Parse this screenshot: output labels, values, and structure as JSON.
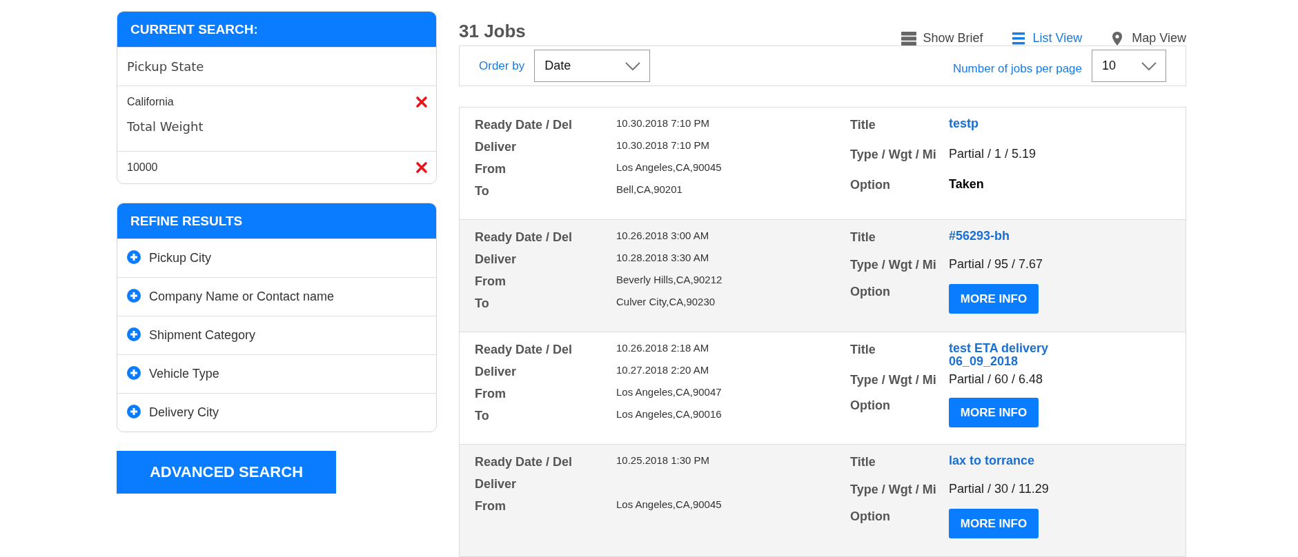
{
  "current_search": {
    "title": "CURRENT SEARCH:",
    "filters": [
      {
        "label": "Pickup State",
        "value": "California"
      },
      {
        "label": "Total Weight",
        "value": "10000"
      }
    ]
  },
  "refine": {
    "title": "REFINE RESULTS",
    "items": [
      {
        "label": "Pickup City"
      },
      {
        "label": "Company Name or Contact name"
      },
      {
        "label": "Shipment Category"
      },
      {
        "label": "Vehicle Type"
      },
      {
        "label": "Delivery City"
      }
    ]
  },
  "advanced_search": "ADVANCED SEARCH",
  "results": {
    "count": "31 Jobs",
    "views": [
      {
        "kind": "brief",
        "label": "Show Brief",
        "selected": false
      },
      {
        "kind": "list",
        "label": "List View",
        "selected": true
      },
      {
        "kind": "map",
        "label": "Map View",
        "selected": false
      }
    ],
    "order_by": {
      "label": "Order by",
      "value": "Date"
    },
    "per_page": {
      "label": "Number of jobs per page",
      "value": "10"
    },
    "jobs": [
      {
        "fields": [
          {
            "label": "Ready Date / Del",
            "value": "10.30.2018 7:10 PM"
          },
          {
            "label": "Deliver",
            "value": "10.30.2018 7:10 PM"
          },
          {
            "label": "From",
            "value": "Los Angeles,CA,90045"
          },
          {
            "label": "To",
            "value": "Bell,CA,90201"
          }
        ],
        "title_label": "Title",
        "title": "testp",
        "type_label": "Type / Wgt / Mi",
        "type": "Partial / 1 / 5.19",
        "option_label": "Option",
        "option": {
          "kind": "status",
          "text": "Taken"
        }
      },
      {
        "fields": [
          {
            "label": "Ready Date / Del",
            "value": "10.26.2018 3:00 AM"
          },
          {
            "label": "Deliver",
            "value": "10.28.2018 3:30 AM"
          },
          {
            "label": "From",
            "value": "Beverly Hills,CA,90212"
          },
          {
            "label": "To",
            "value": "Culver City,CA,90230"
          }
        ],
        "title_label": "Title",
        "title": "#56293-bh",
        "type_label": "Type / Wgt / Mi",
        "type": "Partial / 95 / 7.67",
        "option_label": "Option",
        "option": {
          "kind": "button",
          "text": "MORE INFO"
        }
      },
      {
        "fields": [
          {
            "label": "Ready Date / Del",
            "value": "10.26.2018 2:18 AM"
          },
          {
            "label": "Deliver",
            "value": "10.27.2018 2:20 AM"
          },
          {
            "label": "From",
            "value": "Los Angeles,CA,90047"
          },
          {
            "label": "To",
            "value": "Los Angeles,CA,90016"
          }
        ],
        "title_label": "Title",
        "title": "test ETA delivery 06_09_2018",
        "type_label": "Type / Wgt / Mi",
        "type": "Partial / 60 / 6.48",
        "option_label": "Option",
        "option": {
          "kind": "button",
          "text": "MORE INFO"
        }
      },
      {
        "fields": [
          {
            "label": "Ready Date / Del",
            "value": "10.25.2018 1:30 PM"
          },
          {
            "label": "Deliver"
          },
          {
            "label": "From",
            "value": "Los Angeles,CA,90045"
          }
        ],
        "title_label": "Title",
        "title": "lax to torrance",
        "type_label": "Type / Wgt / Mi",
        "type": "Partial / 30 / 11.29",
        "option_label": "Option",
        "option": {
          "kind": "button",
          "text": "MORE INFO"
        }
      }
    ]
  }
}
